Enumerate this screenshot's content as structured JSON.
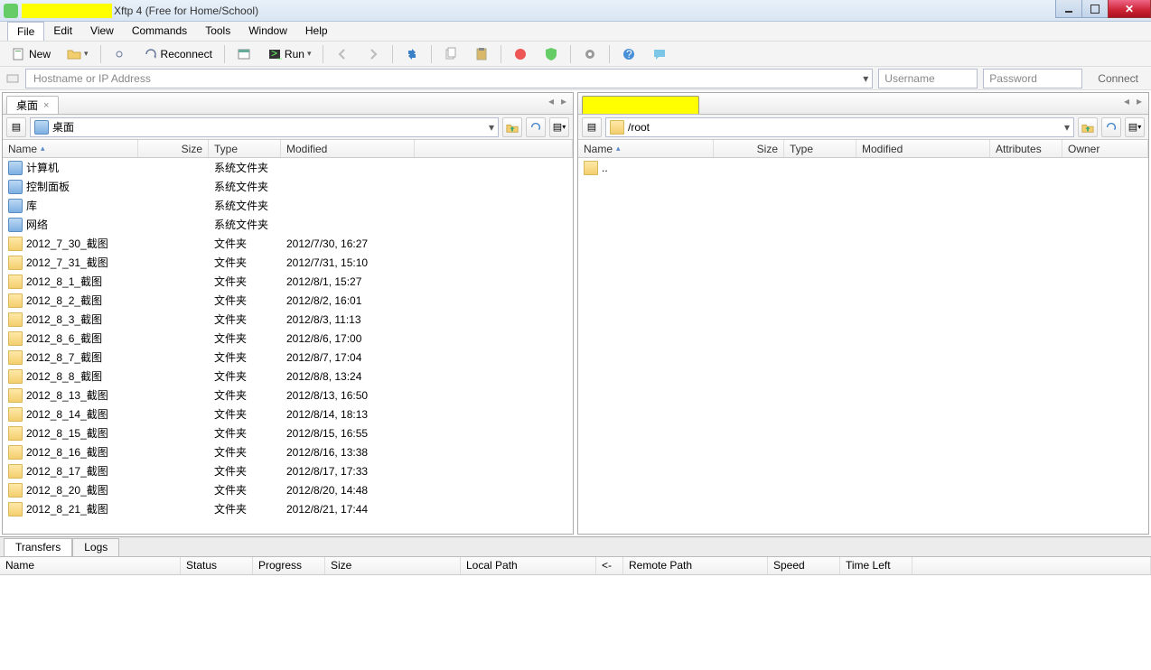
{
  "window": {
    "title": "Xftp 4 (Free for Home/School)"
  },
  "menu": {
    "file": "File",
    "edit": "Edit",
    "view": "View",
    "commands": "Commands",
    "tools": "Tools",
    "window": "Window",
    "help": "Help"
  },
  "toolbar": {
    "new": "New",
    "reconnect": "Reconnect",
    "run": "Run"
  },
  "address": {
    "host_placeholder": "Hostname or IP Address",
    "user_placeholder": "Username",
    "pass_placeholder": "Password",
    "connect": "Connect"
  },
  "left": {
    "tab": "桌面",
    "path": "桌面",
    "columns": {
      "name": "Name",
      "size": "Size",
      "type": "Type",
      "modified": "Modified"
    },
    "colw": {
      "name": 150,
      "size": 78,
      "type": 80,
      "modified": 148
    },
    "rows": [
      {
        "icon": "sys",
        "name": "计算机",
        "size": "",
        "type": "系统文件夹",
        "modified": ""
      },
      {
        "icon": "sys",
        "name": "控制面板",
        "size": "",
        "type": "系统文件夹",
        "modified": ""
      },
      {
        "icon": "sys",
        "name": "库",
        "size": "",
        "type": "系统文件夹",
        "modified": ""
      },
      {
        "icon": "sys",
        "name": "网络",
        "size": "",
        "type": "系统文件夹",
        "modified": ""
      },
      {
        "icon": "folder",
        "name": "2012_7_30_截图",
        "size": "",
        "type": "文件夹",
        "modified": "2012/7/30, 16:27"
      },
      {
        "icon": "folder",
        "name": "2012_7_31_截图",
        "size": "",
        "type": "文件夹",
        "modified": "2012/7/31, 15:10"
      },
      {
        "icon": "folder",
        "name": "2012_8_1_截图",
        "size": "",
        "type": "文件夹",
        "modified": "2012/8/1, 15:27"
      },
      {
        "icon": "folder",
        "name": "2012_8_2_截图",
        "size": "",
        "type": "文件夹",
        "modified": "2012/8/2, 16:01"
      },
      {
        "icon": "folder",
        "name": "2012_8_3_截图",
        "size": "",
        "type": "文件夹",
        "modified": "2012/8/3, 11:13"
      },
      {
        "icon": "folder",
        "name": "2012_8_6_截图",
        "size": "",
        "type": "文件夹",
        "modified": "2012/8/6, 17:00"
      },
      {
        "icon": "folder",
        "name": "2012_8_7_截图",
        "size": "",
        "type": "文件夹",
        "modified": "2012/8/7, 17:04"
      },
      {
        "icon": "folder",
        "name": "2012_8_8_截图",
        "size": "",
        "type": "文件夹",
        "modified": "2012/8/8, 13:24"
      },
      {
        "icon": "folder",
        "name": "2012_8_13_截图",
        "size": "",
        "type": "文件夹",
        "modified": "2012/8/13, 16:50"
      },
      {
        "icon": "folder",
        "name": "2012_8_14_截图",
        "size": "",
        "type": "文件夹",
        "modified": "2012/8/14, 18:13"
      },
      {
        "icon": "folder",
        "name": "2012_8_15_截图",
        "size": "",
        "type": "文件夹",
        "modified": "2012/8/15, 16:55"
      },
      {
        "icon": "folder",
        "name": "2012_8_16_截图",
        "size": "",
        "type": "文件夹",
        "modified": "2012/8/16, 13:38"
      },
      {
        "icon": "folder",
        "name": "2012_8_17_截图",
        "size": "",
        "type": "文件夹",
        "modified": "2012/8/17, 17:33"
      },
      {
        "icon": "folder",
        "name": "2012_8_20_截图",
        "size": "",
        "type": "文件夹",
        "modified": "2012/8/20, 14:48"
      },
      {
        "icon": "folder",
        "name": "2012_8_21_截图",
        "size": "",
        "type": "文件夹",
        "modified": "2012/8/21, 17:44"
      }
    ]
  },
  "right": {
    "path": "/root",
    "columns": {
      "name": "Name",
      "size": "Size",
      "type": "Type",
      "modified": "Modified",
      "attributes": "Attributes",
      "owner": "Owner"
    },
    "colw": {
      "name": 150,
      "size": 78,
      "type": 80,
      "modified": 148,
      "attributes": 80,
      "owner": 80
    },
    "rows": [
      {
        "icon": "folder",
        "name": "..",
        "size": "",
        "type": "",
        "modified": "",
        "attributes": "",
        "owner": ""
      }
    ]
  },
  "transfers": {
    "tabs": {
      "transfers": "Transfers",
      "logs": "Logs"
    },
    "columns": {
      "name": "Name",
      "status": "Status",
      "progress": "Progress",
      "size": "Size",
      "localpath": "Local Path",
      "arrow": "<->",
      "remotepath": "Remote Path",
      "speed": "Speed",
      "timeleft": "Time Left"
    },
    "colw": {
      "name": 200,
      "status": 80,
      "progress": 80,
      "size": 150,
      "localpath": 150,
      "arrow": 30,
      "remotepath": 160,
      "speed": 80,
      "timeleft": 80
    }
  }
}
